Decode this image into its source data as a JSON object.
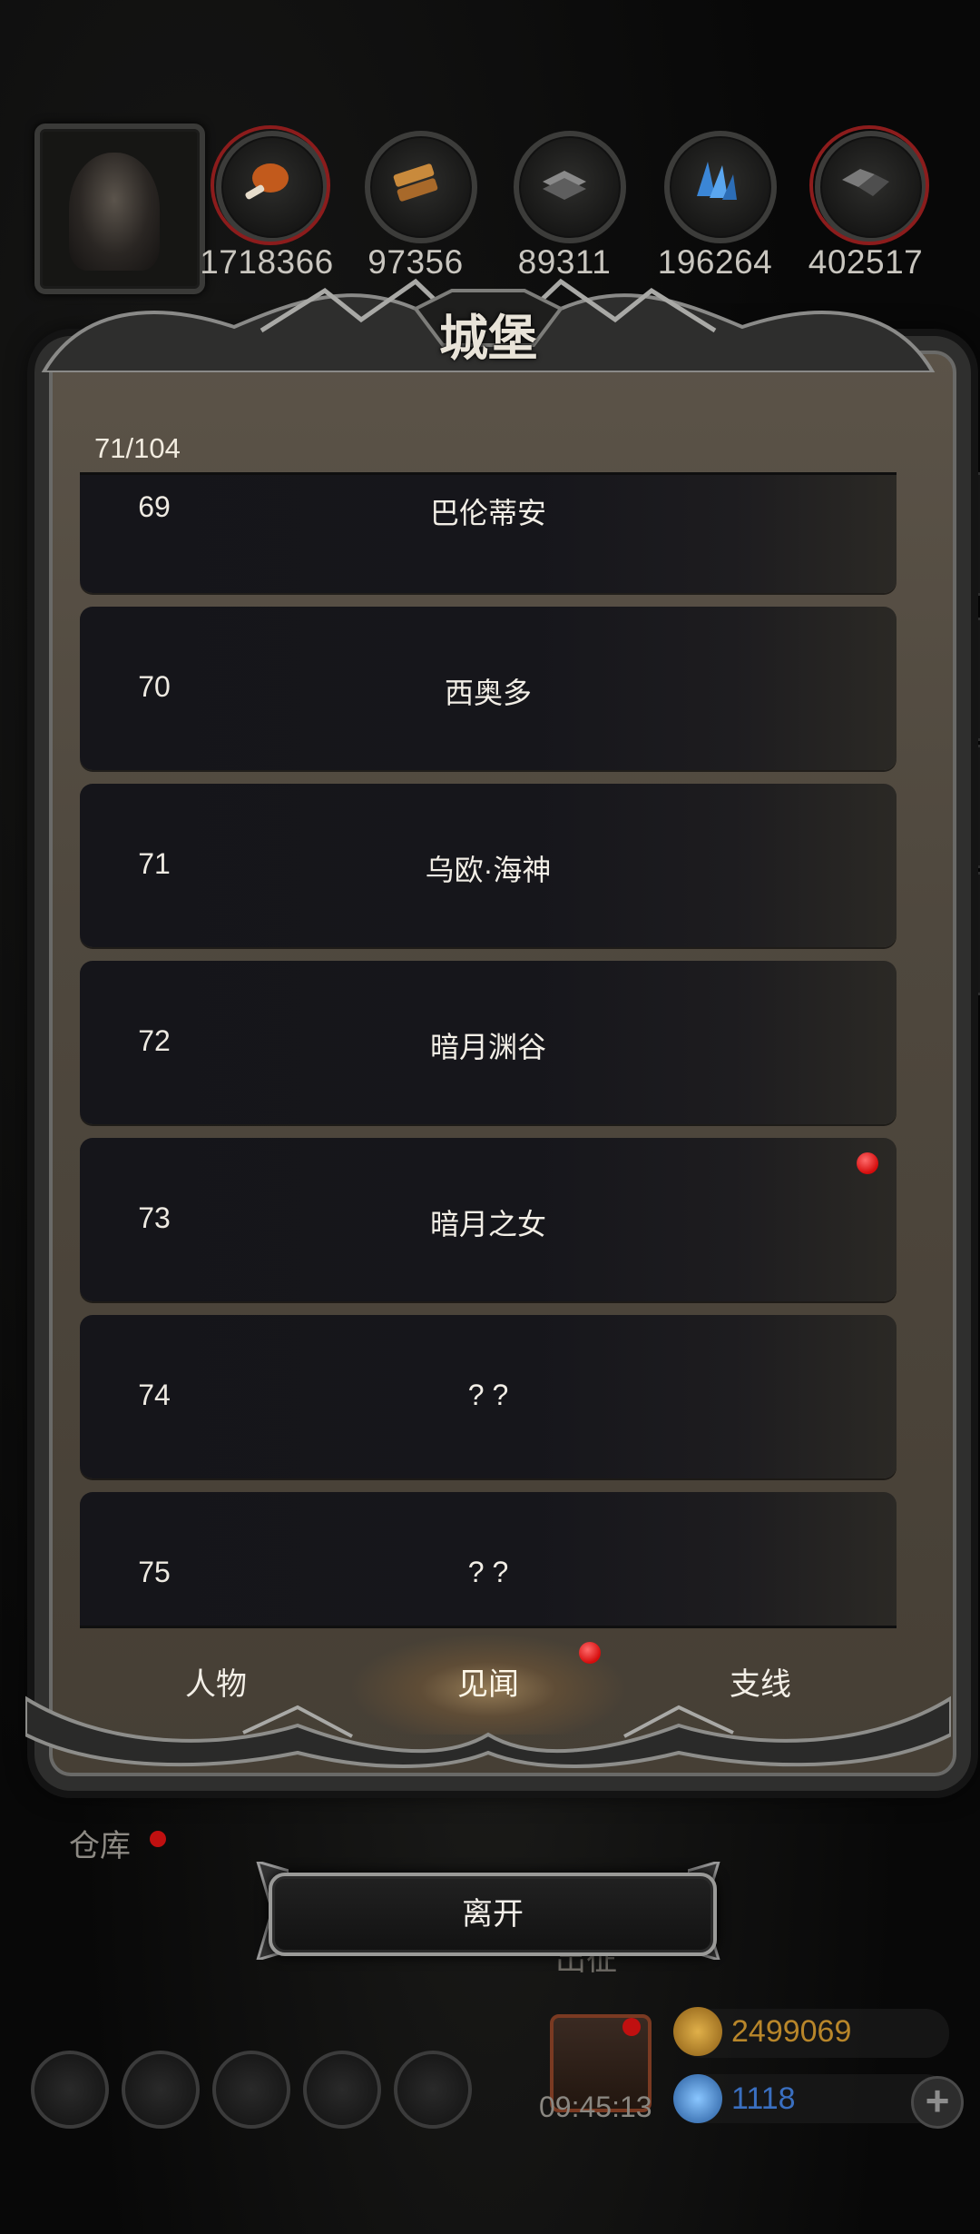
{
  "resources": [
    {
      "icon": "meat-icon",
      "value": "1718366",
      "ring": "#8c1c1c"
    },
    {
      "icon": "wood-icon",
      "value": "97356",
      "ring": "#3a3a38"
    },
    {
      "icon": "iron-icon",
      "value": "89311",
      "ring": "#3a3a38"
    },
    {
      "icon": "crystal-icon",
      "value": "196264",
      "ring": "#3a3a38"
    },
    {
      "icon": "stone-icon",
      "value": "402517",
      "ring": "#8c1c1c"
    }
  ],
  "dialog": {
    "title": "城堡",
    "counter": "71/104",
    "rows": [
      {
        "index": "69",
        "name": "巴伦蒂安",
        "alert": false
      },
      {
        "index": "70",
        "name": "西奥多",
        "alert": false
      },
      {
        "index": "71",
        "name": "乌欧·海神",
        "alert": false
      },
      {
        "index": "72",
        "name": "暗月渊谷",
        "alert": false
      },
      {
        "index": "73",
        "name": "暗月之女",
        "alert": true
      },
      {
        "index": "74",
        "name": "? ?",
        "alert": false
      },
      {
        "index": "75",
        "name": "? ?",
        "alert": false
      }
    ],
    "tabs": [
      {
        "label": "人物",
        "active": false,
        "alert": false
      },
      {
        "label": "见闻",
        "active": true,
        "alert": true
      },
      {
        "label": "支线",
        "active": false,
        "alert": false
      }
    ],
    "leave_label": "离开"
  },
  "hud": {
    "warehouse_label": "仓库",
    "expedition_label": "出征",
    "timer": "09:45:13",
    "gold": "2499069",
    "gems": "1118"
  },
  "colors": {
    "alert_red": "#d50b0b",
    "panel_brown": "#4f483e",
    "row_dark": "#15151a",
    "gold_text": "#b8862a",
    "gem_text": "#3a6fc0"
  }
}
